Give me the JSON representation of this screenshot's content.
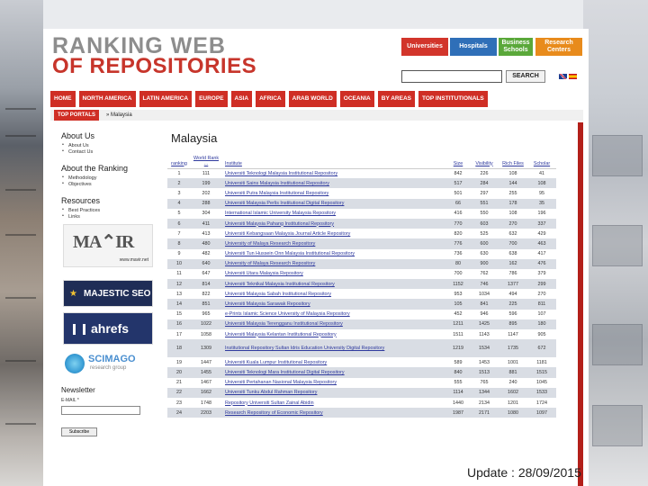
{
  "header": {
    "logo_line1": "RANKING WEB",
    "logo_line2": "OF REPOSITORIES",
    "categories": [
      "Universities",
      "Hospitals",
      "Business Schools",
      "Research Centers"
    ],
    "search_button": "SEARCH"
  },
  "nav": [
    "HOME",
    "NORTH AMERICA",
    "LATIN AMERICA",
    "EUROPE",
    "ASIA",
    "AFRICA",
    "ARAB WORLD",
    "OCEANIA",
    "BY AREAS",
    "TOP INSTITUTIONALS"
  ],
  "breadcrumb": {
    "tab": "TOP PORTALS",
    "current": "» Malaysia"
  },
  "sidebar": {
    "about_heading": "About Us",
    "about_items": [
      "About Us",
      "Contact Us"
    ],
    "ranking_heading": "About the Ranking",
    "ranking_items": [
      "Methodology",
      "Objectives"
    ],
    "resources_heading": "Resources",
    "resources_items": [
      "Best Practices",
      "Links"
    ],
    "ad_mavir_url": "www.mavir.net",
    "ad_majestic": "MAJESTIC SEO",
    "ad_ahrefs": "ahrefs",
    "ad_scimago": "SCIMAGO",
    "ad_scimago_sub": "research group",
    "newsletter_heading": "Newsletter",
    "newsletter_label": "E-MAIL *",
    "newsletter_button": "Subscribe"
  },
  "main": {
    "title": "Malaysia",
    "columns": [
      "ranking",
      "World Rank ...",
      "Institute",
      "Size",
      "Visibility",
      "Rich Files",
      "Scholar"
    ],
    "rows": [
      [
        "1",
        "111",
        "Universiti Teknologi Malaysia Institutional Repository",
        "842",
        "226",
        "108",
        "41"
      ],
      [
        "2",
        "199",
        "Universiti Sains Malaysia Institutional Repository",
        "517",
        "284",
        "144",
        "108"
      ],
      [
        "3",
        "202",
        "Universiti Putra Malaysia Institutional Repository",
        "501",
        "297",
        "255",
        "95"
      ],
      [
        "4",
        "288",
        "Universiti Malaysia Perlis Institutional Digital Repository",
        "66",
        "551",
        "178",
        "35"
      ],
      [
        "5",
        "304",
        "International Islamic University Malaysia Repository",
        "416",
        "550",
        "108",
        "196"
      ],
      [
        "6",
        "411",
        "Universiti Malaysia Pahang Institutional Repository",
        "770",
        "603",
        "270",
        "337"
      ],
      [
        "7",
        "413",
        "Universiti Kebangsaan Malaysia Journal Article Repository",
        "820",
        "525",
        "632",
        "429"
      ],
      [
        "8",
        "480",
        "University of Malaya Research Repository",
        "776",
        "600",
        "700",
        "463"
      ],
      [
        "9",
        "482",
        "Universiti Tun Hussein Onn Malaysia Institutional Repository",
        "736",
        "630",
        "638",
        "417"
      ],
      [
        "10",
        "640",
        "University of Malaya Research Repository",
        "80",
        "900",
        "162",
        "476"
      ],
      [
        "11",
        "647",
        "Universiti Utara Malaysia Repository",
        "700",
        "762",
        "786",
        "379"
      ],
      [
        "12",
        "814",
        "Universiti Teknikal Malaysia Institutional Repository",
        "1152",
        "746",
        "1377",
        "299"
      ],
      [
        "13",
        "822",
        "Universiti Malaysia Sabah Institutional Repository",
        "953",
        "1034",
        "494",
        "270"
      ],
      [
        "14",
        "851",
        "Universiti Malaysia Sarawak Repository",
        "105",
        "841",
        "225",
        "811"
      ],
      [
        "15",
        "965",
        "e-Prints Islamic Science University of Malaysia Repository",
        "452",
        "946",
        "596",
        "107"
      ],
      [
        "16",
        "1022",
        "Universiti Malaysia Terengganu Institutional Repository",
        "1211",
        "1425",
        "895",
        "180"
      ],
      [
        "17",
        "1058",
        "Universiti Malaysia Kelantan Institutional Repository",
        "1511",
        "1143",
        "1147",
        "905"
      ],
      [
        "18",
        "1309",
        "Institutional Repository Sultan Idris Education University Digital Repository",
        "1219",
        "1534",
        "1735",
        "672"
      ],
      [
        "19",
        "1447",
        "Universiti Kuala Lumpur Institutional Repository",
        "589",
        "1453",
        "1001",
        "1181"
      ],
      [
        "20",
        "1455",
        "Universiti Teknologi Mara Institutional Digital Repository",
        "840",
        "1513",
        "881",
        "1515"
      ],
      [
        "21",
        "1467",
        "Universiti Pertahanan Nasional Malaysia Repository",
        "555",
        "765",
        "240",
        "1045"
      ],
      [
        "22",
        "1662",
        "Universiti Tunku Abdul Rahman Repository",
        "1114",
        "1344",
        "1602",
        "1533"
      ],
      [
        "23",
        "1748",
        "Repository Universiti Sultan Zainal Abidin",
        "1440",
        "2134",
        "1201",
        "1724"
      ],
      [
        "24",
        "2203",
        "Research Repository of Economic Repository",
        "1987",
        "2171",
        "1080",
        "1097"
      ]
    ]
  },
  "footer": {
    "update": "Update : 28/09/2015"
  }
}
